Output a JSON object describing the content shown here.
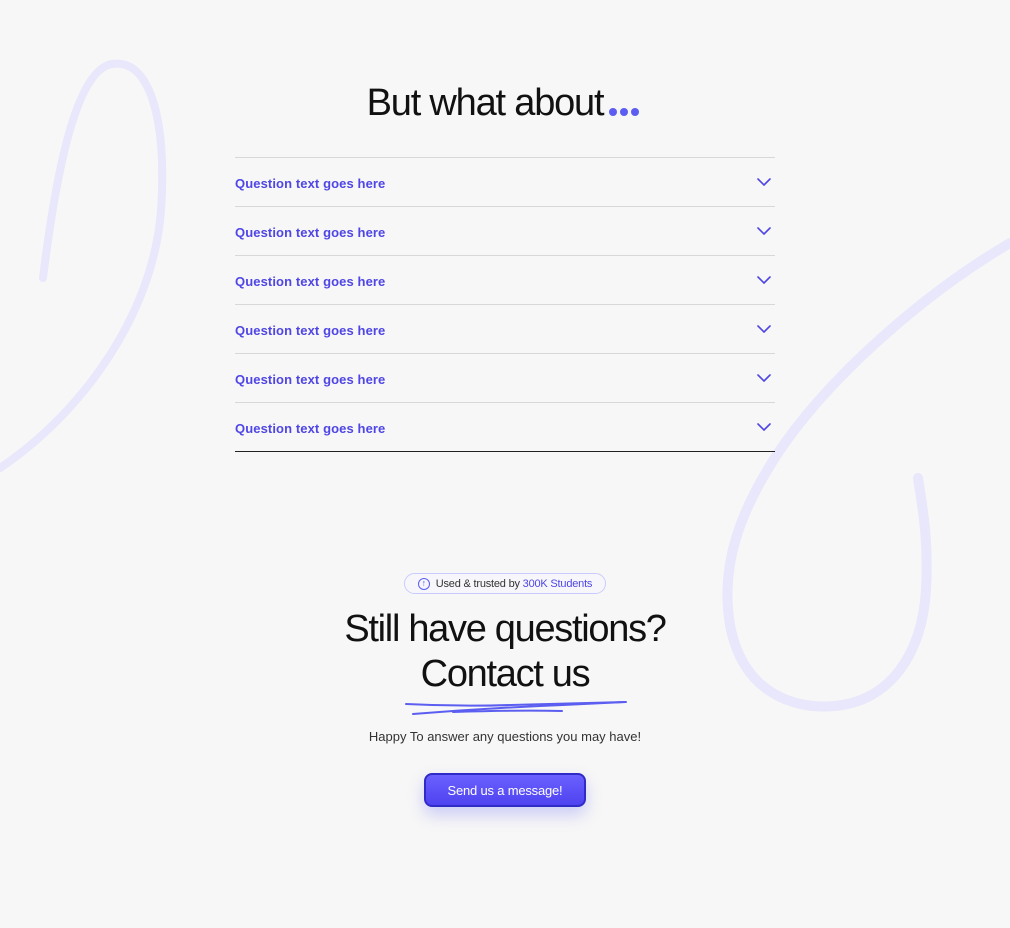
{
  "faq": {
    "title": "But what about",
    "items": [
      {
        "question": "Question text goes here"
      },
      {
        "question": "Question text goes here"
      },
      {
        "question": "Question text goes here"
      },
      {
        "question": "Question text goes here"
      },
      {
        "question": "Question text goes here"
      },
      {
        "question": "Question text goes here"
      }
    ]
  },
  "contact": {
    "badge": {
      "prefix": "Used & trusted by",
      "highlight": "300K Students"
    },
    "headline_line1": "Still have questions?",
    "headline_line2": "Contact us",
    "subtitle": "Happy To answer any questions you may have!",
    "button_label": "Send us a message!"
  },
  "icons": {
    "dots": "dots-icon",
    "chevron": "chevron-down-icon",
    "badge": "arrow-up-circle-icon"
  },
  "colors": {
    "accent": "#5b5ef0",
    "accent_text": "#4f46e5",
    "background": "#f7f7f7",
    "swoosh": "#e8e7fb"
  }
}
